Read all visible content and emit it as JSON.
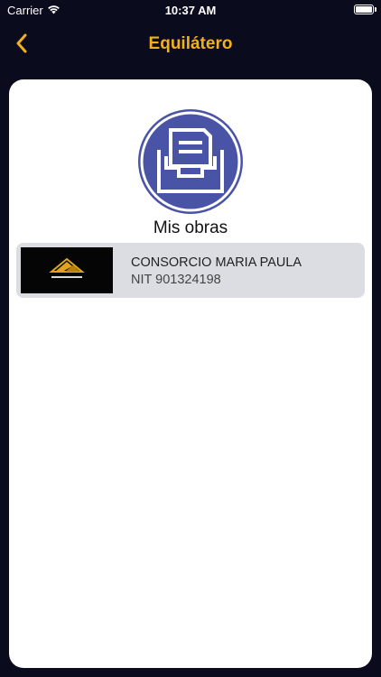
{
  "status_bar": {
    "carrier": "Carrier",
    "time": "10:37 AM",
    "icons": [
      "wifi-icon",
      "battery-icon"
    ]
  },
  "nav": {
    "title": "Equilátero",
    "back_icon": "chevron-left-icon"
  },
  "colors": {
    "background": "#0b0b1e",
    "accent": "#f2b01e",
    "card": "#ffffff",
    "list_item": "#dcdde2",
    "hero_circle": "#4a54a6"
  },
  "main": {
    "hero_icon": "inbox-tray-icon",
    "section_title": "Mis obras",
    "items": [
      {
        "name": "CONSORCIO MARIA PAULA",
        "nit": "NIT 901324198",
        "logo_icon": "equilatero-logo-icon"
      }
    ]
  }
}
